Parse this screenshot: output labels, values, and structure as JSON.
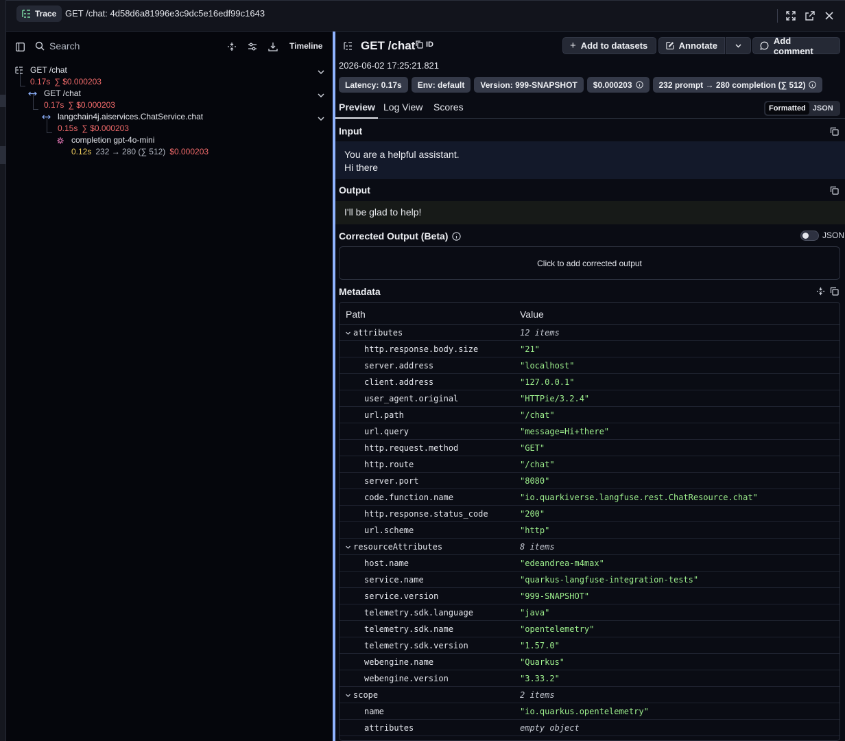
{
  "header": {
    "badge": "Trace",
    "title": "GET /chat: 4d58d6a81996e3c9dc5e16edf99c1643"
  },
  "left": {
    "search_placeholder": "Search",
    "timeline_label": "Timeline",
    "nodes": [
      {
        "name": "GET /chat",
        "latency": "0.17s",
        "cost": "∑ $0.000203"
      },
      {
        "name": "GET /chat",
        "latency": "0.17s",
        "cost": "∑ $0.000203"
      },
      {
        "name": "langchain4j.aiservices.ChatService.chat",
        "latency": "0.15s",
        "cost": "∑ $0.000203"
      },
      {
        "name": "completion gpt-4o-mini",
        "latency": "0.12s",
        "tokens": "232 → 280 (∑ 512)",
        "cost": "$0.000203"
      }
    ]
  },
  "right": {
    "title": "GET /chat",
    "id_label": "ID",
    "buttons": {
      "add_datasets": "Add to datasets",
      "annotate": "Annotate",
      "add_comment": "Add comment"
    },
    "timestamp": "2026-06-02 17:25:21.821",
    "badges": {
      "latency": "Latency: 0.17s",
      "env": "Env: default",
      "version": "Version: 999-SNAPSHOT",
      "cost": "$0.000203",
      "tokens": "232 prompt → 280 completion (∑ 512)"
    },
    "tabs": [
      "Preview",
      "Log View",
      "Scores"
    ],
    "format_options": [
      "Formatted",
      "JSON"
    ],
    "input": {
      "label": "Input",
      "lines": [
        "You are a helpful assistant.",
        "Hi there"
      ]
    },
    "output": {
      "label": "Output",
      "text": "I'll be glad to help!"
    },
    "corrected": {
      "label": "Corrected Output (Beta)",
      "toggle_label": "JSON",
      "placeholder": "Click to add corrected output"
    },
    "metadata": {
      "label": "Metadata",
      "col_path": "Path",
      "col_value": "Value",
      "rows": [
        {
          "group": true,
          "k": "attributes",
          "v": "12 items"
        },
        {
          "k": "http.response.body.size",
          "v": "\"21\""
        },
        {
          "k": "server.address",
          "v": "\"localhost\""
        },
        {
          "k": "client.address",
          "v": "\"127.0.0.1\""
        },
        {
          "k": "user_agent.original",
          "v": "\"HTTPie/3.2.4\""
        },
        {
          "k": "url.path",
          "v": "\"/chat\""
        },
        {
          "k": "url.query",
          "v": "\"message=Hi+there\""
        },
        {
          "k": "http.request.method",
          "v": "\"GET\""
        },
        {
          "k": "http.route",
          "v": "\"/chat\""
        },
        {
          "k": "server.port",
          "v": "\"8080\""
        },
        {
          "k": "code.function.name",
          "v": "\"io.quarkiverse.langfuse.rest.ChatResource.chat\""
        },
        {
          "k": "http.response.status_code",
          "v": "\"200\""
        },
        {
          "k": "url.scheme",
          "v": "\"http\""
        },
        {
          "group": true,
          "k": "resourceAttributes",
          "v": "8 items"
        },
        {
          "k": "host.name",
          "v": "\"edeandrea-m4max\""
        },
        {
          "k": "service.name",
          "v": "\"quarkus-langfuse-integration-tests\""
        },
        {
          "k": "service.version",
          "v": "\"999-SNAPSHOT\""
        },
        {
          "k": "telemetry.sdk.language",
          "v": "\"java\""
        },
        {
          "k": "telemetry.sdk.name",
          "v": "\"opentelemetry\""
        },
        {
          "k": "telemetry.sdk.version",
          "v": "\"1.57.0\""
        },
        {
          "k": "webengine.name",
          "v": "\"Quarkus\""
        },
        {
          "k": "webengine.version",
          "v": "\"3.33.2\""
        },
        {
          "group": true,
          "k": "scope",
          "v": "2 items"
        },
        {
          "k": "name",
          "v": "\"io.quarkus.opentelemetry\""
        },
        {
          "k": "attributes",
          "v": "empty object",
          "muted": true
        }
      ]
    }
  }
}
